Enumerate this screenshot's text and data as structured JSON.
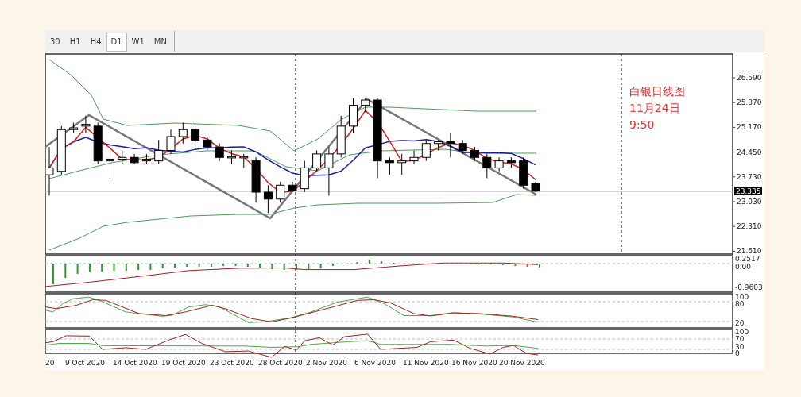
{
  "toolbar": {
    "tabs": [
      {
        "label": "30",
        "selected": false
      },
      {
        "label": "H1",
        "selected": false
      },
      {
        "label": "H4",
        "selected": false
      },
      {
        "label": "D1",
        "selected": true
      },
      {
        "label": "W1",
        "selected": false
      },
      {
        "label": "MN",
        "selected": false
      }
    ]
  },
  "chart": {
    "price_axis": [
      "26.590",
      "25.870",
      "25.170",
      "24.450",
      "23.730",
      "23.030",
      "22.310",
      "21.610"
    ],
    "current_price": "23.335",
    "annotation": [
      "白银日线图",
      "11月24日",
      "9:50"
    ],
    "macd_axis": [
      "0.2517",
      "0.00",
      "-0.9603"
    ],
    "stochastic_axis": [
      "100",
      "80",
      "20"
    ],
    "rsi_axis": [
      "100",
      "70",
      "30",
      "0"
    ],
    "date_axis": [
      "20",
      "9 Oct 2020",
      "14 Oct 2020",
      "19 Oct 2020",
      "23 Oct 2020",
      "28 Oct 2020",
      "2 Nov 2020",
      "6 Nov 2020",
      "11 Nov 2020",
      "16 Nov 2020",
      "20 Nov 2020"
    ]
  }
}
